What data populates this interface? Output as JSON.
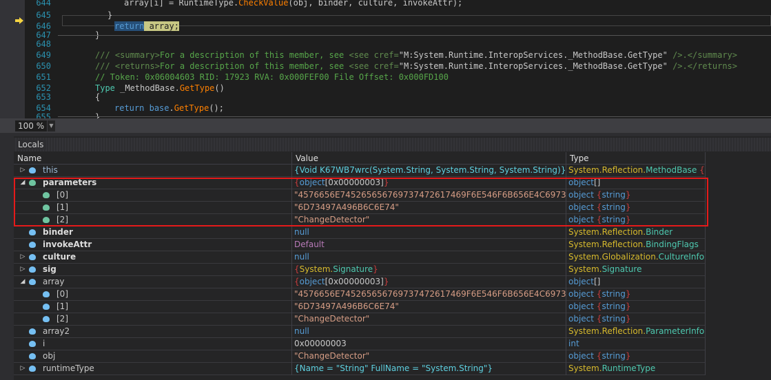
{
  "editor": {
    "current_line": 646,
    "lines": [
      {
        "n": "644",
        "indent": 190,
        "tokens": [
          {
            "t": "array[i] = RuntimeType.",
            "c": "cmx"
          },
          {
            "t": "CheckValue",
            "c": "fn"
          },
          {
            "t": "(obj, binder, culture, invokeAttr);",
            "c": "cmx"
          }
        ]
      },
      {
        "n": "645",
        "indent": 166,
        "tokens": [
          {
            "t": "}",
            "c": "cmx"
          }
        ]
      },
      {
        "n": "646",
        "indent": 176,
        "tokens": [
          {
            "t": "return",
            "c": "hl-ret"
          },
          {
            "t": " array;",
            "c": "hl-arr"
          }
        ]
      },
      {
        "n": "647",
        "indent": 148,
        "tokens": [
          {
            "t": "}",
            "c": "cmx"
          }
        ]
      },
      {
        "n": "648",
        "indent": 148,
        "tokens": []
      },
      {
        "n": "649",
        "indent": 148,
        "tokens": [
          {
            "t": "/// <summary>",
            "c": "cmg"
          },
          {
            "t": "For a description of this member, see ",
            "c": "cm"
          },
          {
            "t": "<see cref=",
            "c": "cmg"
          },
          {
            "t": "\"M:System.Runtime.InteropServices._MethodBase.GetType\"",
            "c": "cmx"
          },
          {
            "t": " />.</summary>",
            "c": "cmg"
          }
        ]
      },
      {
        "n": "650",
        "indent": 148,
        "tokens": [
          {
            "t": "/// <returns>",
            "c": "cmg"
          },
          {
            "t": "For a description of this member, see ",
            "c": "cm"
          },
          {
            "t": "<see cref=",
            "c": "cmg"
          },
          {
            "t": "\"M:System.Runtime.InteropServices._MethodBase.GetType\"",
            "c": "cmx"
          },
          {
            "t": " />.</returns>",
            "c": "cmg"
          }
        ]
      },
      {
        "n": "651",
        "indent": 148,
        "tokens": [
          {
            "t": "// Token: 0x06004603 RID: 17923 RVA: 0x000FEF00 File Offset: 0x000FD100",
            "c": "cm"
          }
        ]
      },
      {
        "n": "652",
        "indent": 148,
        "tokens": [
          {
            "t": "Type",
            "c": "cls"
          },
          {
            "t": " _MethodBase.",
            "c": "cmx"
          },
          {
            "t": "GetType",
            "c": "fn"
          },
          {
            "t": "()",
            "c": "cmx"
          }
        ]
      },
      {
        "n": "653",
        "indent": 148,
        "tokens": [
          {
            "t": "{",
            "c": "cmx"
          }
        ]
      },
      {
        "n": "654",
        "indent": 176,
        "tokens": [
          {
            "t": "return",
            "c": "kw"
          },
          {
            "t": " ",
            "c": "cmx"
          },
          {
            "t": "base",
            "c": "kw"
          },
          {
            "t": ".",
            "c": "cmx"
          },
          {
            "t": "GetType",
            "c": "fn"
          },
          {
            "t": "();",
            "c": "cmx"
          }
        ]
      },
      {
        "n": "655",
        "indent": 148,
        "tokens": [
          {
            "t": "}",
            "c": "cmx"
          }
        ]
      },
      {
        "n": "656",
        "indent": 148,
        "tokens": []
      }
    ]
  },
  "zoom": {
    "value": "100 %"
  },
  "locals": {
    "title": "Locals",
    "columns": [
      "Name",
      "Value",
      "Type"
    ],
    "highlight_color": "#e51a1a",
    "rows": [
      {
        "name": "this",
        "level": 0,
        "expander": "collapsed",
        "bold": false,
        "icon": "field",
        "nameColor": "#9bb8d3",
        "value": [
          {
            "t": "{Void K67WB7wrc(System.String, System.String, System.String)}",
            "c": "cy"
          }
        ],
        "type": [
          {
            "t": "System.Reflection.",
            "c": "ty"
          },
          {
            "t": "MethodBase",
            "c": "cl"
          },
          {
            "t": " {",
            "c": "br"
          },
          {
            "t": "Sy...",
            "c": "ty"
          }
        ]
      },
      {
        "name": "parameters",
        "level": 0,
        "expander": "expanded",
        "bold": true,
        "icon": "param",
        "value": [
          {
            "t": "{",
            "c": "br"
          },
          {
            "t": "object",
            "c": "kw"
          },
          {
            "t": "[0x00000003]",
            "c": "pl"
          },
          {
            "t": "}",
            "c": "br"
          }
        ],
        "type": [
          {
            "t": "object",
            "c": "kw"
          },
          {
            "t": "[]",
            "c": "pl"
          }
        ]
      },
      {
        "name": "[0]",
        "level": 1,
        "bold": false,
        "icon": "param",
        "value": [
          {
            "t": "\"4576656E745265656769737472617469F6E546F6B656E4C6973745769746843...\"",
            "c": "str"
          }
        ],
        "type": [
          {
            "t": "object ",
            "c": "kw"
          },
          {
            "t": "{",
            "c": "br"
          },
          {
            "t": "string",
            "c": "kw"
          },
          {
            "t": "}",
            "c": "br"
          }
        ]
      },
      {
        "name": "[1]",
        "level": 1,
        "bold": false,
        "icon": "param",
        "value": [
          {
            "t": "\"6D73497A496B6C6E74\"",
            "c": "str"
          }
        ],
        "type": [
          {
            "t": "object ",
            "c": "kw"
          },
          {
            "t": "{",
            "c": "br"
          },
          {
            "t": "string",
            "c": "kw"
          },
          {
            "t": "}",
            "c": "br"
          }
        ]
      },
      {
        "name": "[2]",
        "level": 1,
        "bold": false,
        "icon": "param",
        "value": [
          {
            "t": "\"ChangeDetector\"",
            "c": "str"
          }
        ],
        "type": [
          {
            "t": "object ",
            "c": "kw"
          },
          {
            "t": "{",
            "c": "br"
          },
          {
            "t": "string",
            "c": "kw"
          },
          {
            "t": "}",
            "c": "br"
          }
        ]
      },
      {
        "name": "binder",
        "level": 0,
        "bold": true,
        "icon": "field",
        "value": [
          {
            "t": "null",
            "c": "kw"
          }
        ],
        "type": [
          {
            "t": "System.Reflection.",
            "c": "ty"
          },
          {
            "t": "Binder",
            "c": "cl"
          }
        ]
      },
      {
        "name": "invokeAttr",
        "level": 0,
        "bold": true,
        "icon": "field",
        "value": [
          {
            "t": "Default",
            "c": "en"
          }
        ],
        "type": [
          {
            "t": "System.Reflection.",
            "c": "ty"
          },
          {
            "t": "BindingFlags",
            "c": "cl"
          }
        ]
      },
      {
        "name": "culture",
        "level": 0,
        "expander": "collapsed",
        "bold": true,
        "icon": "field",
        "value": [
          {
            "t": "null",
            "c": "kw"
          }
        ],
        "type": [
          {
            "t": "System.Globalization.",
            "c": "ty"
          },
          {
            "t": "CultureInfo",
            "c": "cl"
          }
        ]
      },
      {
        "name": "sig",
        "level": 0,
        "expander": "collapsed",
        "bold": true,
        "icon": "field",
        "value": [
          {
            "t": "{",
            "c": "br"
          },
          {
            "t": "System.",
            "c": "ty"
          },
          {
            "t": "Signature",
            "c": "cl"
          },
          {
            "t": "}",
            "c": "br"
          }
        ],
        "type": [
          {
            "t": "System.",
            "c": "ty"
          },
          {
            "t": "Signature",
            "c": "cl"
          }
        ]
      },
      {
        "name": "array",
        "level": 0,
        "expander": "expanded",
        "bold": false,
        "icon": "field",
        "value": [
          {
            "t": "{",
            "c": "br"
          },
          {
            "t": "object",
            "c": "kw"
          },
          {
            "t": "[0x00000003]",
            "c": "pl"
          },
          {
            "t": "}",
            "c": "br"
          }
        ],
        "type": [
          {
            "t": "object",
            "c": "kw"
          },
          {
            "t": "[]",
            "c": "pl"
          }
        ]
      },
      {
        "name": "[0]",
        "level": 1,
        "bold": false,
        "icon": "field",
        "value": [
          {
            "t": "\"4576656E745265656769737472617469F6E546F6B656E4C6973745769746843...\"",
            "c": "str"
          }
        ],
        "type": [
          {
            "t": "object ",
            "c": "kw"
          },
          {
            "t": "{",
            "c": "br"
          },
          {
            "t": "string",
            "c": "kw"
          },
          {
            "t": "}",
            "c": "br"
          }
        ]
      },
      {
        "name": "[1]",
        "level": 1,
        "bold": false,
        "icon": "field",
        "value": [
          {
            "t": "\"6D73497A496B6C6E74\"",
            "c": "str"
          }
        ],
        "type": [
          {
            "t": "object ",
            "c": "kw"
          },
          {
            "t": "{",
            "c": "br"
          },
          {
            "t": "string",
            "c": "kw"
          },
          {
            "t": "}",
            "c": "br"
          }
        ]
      },
      {
        "name": "[2]",
        "level": 1,
        "bold": false,
        "icon": "field",
        "value": [
          {
            "t": "\"ChangeDetector\"",
            "c": "str"
          }
        ],
        "type": [
          {
            "t": "object ",
            "c": "kw"
          },
          {
            "t": "{",
            "c": "br"
          },
          {
            "t": "string",
            "c": "kw"
          },
          {
            "t": "}",
            "c": "br"
          }
        ]
      },
      {
        "name": "array2",
        "level": 0,
        "bold": false,
        "icon": "field",
        "value": [
          {
            "t": "null",
            "c": "kw"
          }
        ],
        "type": [
          {
            "t": "System.Reflection.",
            "c": "ty"
          },
          {
            "t": "ParameterInfo",
            "c": "cl"
          },
          {
            "t": "[]",
            "c": "pl"
          }
        ]
      },
      {
        "name": "i",
        "level": 0,
        "bold": false,
        "icon": "field",
        "value": [
          {
            "t": "0x00000003",
            "c": "pl"
          }
        ],
        "type": [
          {
            "t": "int",
            "c": "kw"
          }
        ]
      },
      {
        "name": "obj",
        "level": 0,
        "bold": false,
        "icon": "field",
        "value": [
          {
            "t": "\"ChangeDetector\"",
            "c": "str"
          }
        ],
        "type": [
          {
            "t": "object ",
            "c": "kw"
          },
          {
            "t": "{",
            "c": "br"
          },
          {
            "t": "string",
            "c": "kw"
          },
          {
            "t": "}",
            "c": "br"
          }
        ]
      },
      {
        "name": "runtimeType",
        "level": 0,
        "expander": "collapsed",
        "bold": false,
        "icon": "field",
        "value": [
          {
            "t": "{Name = \"String\" FullName = \"System.String\"}",
            "c": "cy"
          }
        ],
        "type": [
          {
            "t": "System.",
            "c": "ty"
          },
          {
            "t": "RuntimeType",
            "c": "cl"
          }
        ]
      }
    ]
  }
}
